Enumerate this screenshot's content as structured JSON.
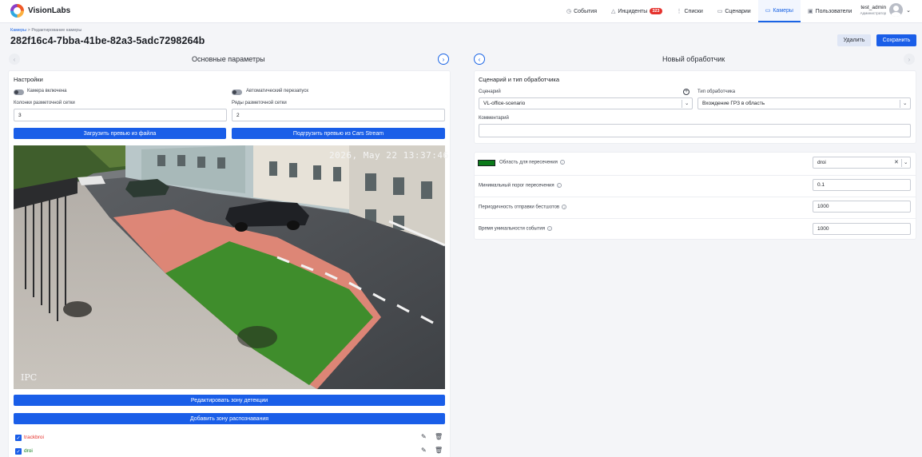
{
  "app": {
    "name": "VisionLabs"
  },
  "nav": {
    "items": [
      {
        "label": "События",
        "icon": "clock-icon"
      },
      {
        "label": "Инциденты",
        "icon": "warning-icon",
        "badge": "323"
      },
      {
        "label": "Списки",
        "icon": "list-icon"
      },
      {
        "label": "Сценарии",
        "icon": "scenario-icon"
      },
      {
        "label": "Камеры",
        "icon": "camera-icon",
        "active": true
      },
      {
        "label": "Пользователи",
        "icon": "users-icon"
      }
    ]
  },
  "user": {
    "name": "test_admin",
    "role": "Администратор"
  },
  "breadcrumb": {
    "root": "Камеры",
    "separator": ">",
    "current": "Редактирование камеры"
  },
  "page": {
    "title": "282f16c4-7bba-41be-82a3-5adc7298264b"
  },
  "actions": {
    "delete_label": "Удалить",
    "save_label": "Сохранить"
  },
  "left": {
    "title": "Основные параметры",
    "settings": {
      "heading": "Настройки",
      "camera_enabled_label": "Камера включена",
      "camera_enabled": false,
      "auto_restart_label": "Автоматический перезапуск",
      "auto_restart": false,
      "grid_cols_label": "Колонки разметочной сетки",
      "grid_cols_value": "3",
      "grid_rows_label": "Ряды разметочной сетки",
      "grid_rows_value": "2",
      "upload_file_label": "Загрузить превью из файла",
      "upload_stream_label": "Подгрузить превью из Cars Stream"
    },
    "preview": {
      "timestamp": "2026, May 22 13:37:46",
      "camera_label": "IPC"
    },
    "edit_zone_label": "Редактировать зону детекции",
    "add_zone_label": "Добавить зону распознавания",
    "zones": [
      {
        "name": "trackbroi",
        "color": "#e5322d",
        "checked": true
      },
      {
        "name": "droi",
        "color": "#0b7a1a",
        "checked": true
      }
    ]
  },
  "right": {
    "title": "Новый обработчик",
    "scenario_card": {
      "heading": "Сценарий и тип обработчика",
      "scenario_label": "Сценарий",
      "scenario_value": "VL-office-scenario",
      "type_label": "Тип обработчика",
      "type_value": "Вхождение ГРЗ в область",
      "comment_label": "Комментарий",
      "comment_value": ""
    },
    "params": {
      "intersection_label": "Область для пересечения",
      "intersection_color": "#0b7a1a",
      "intersection_value": "droi",
      "min_threshold_label": "Минимальный порог пересечения",
      "min_threshold_value": "0.1",
      "bestshot_period_label": "Периодичность отправки бестшотов",
      "bestshot_period_value": "1000",
      "uniqueness_label": "Время уникальности события",
      "uniqueness_value": "1000"
    }
  }
}
